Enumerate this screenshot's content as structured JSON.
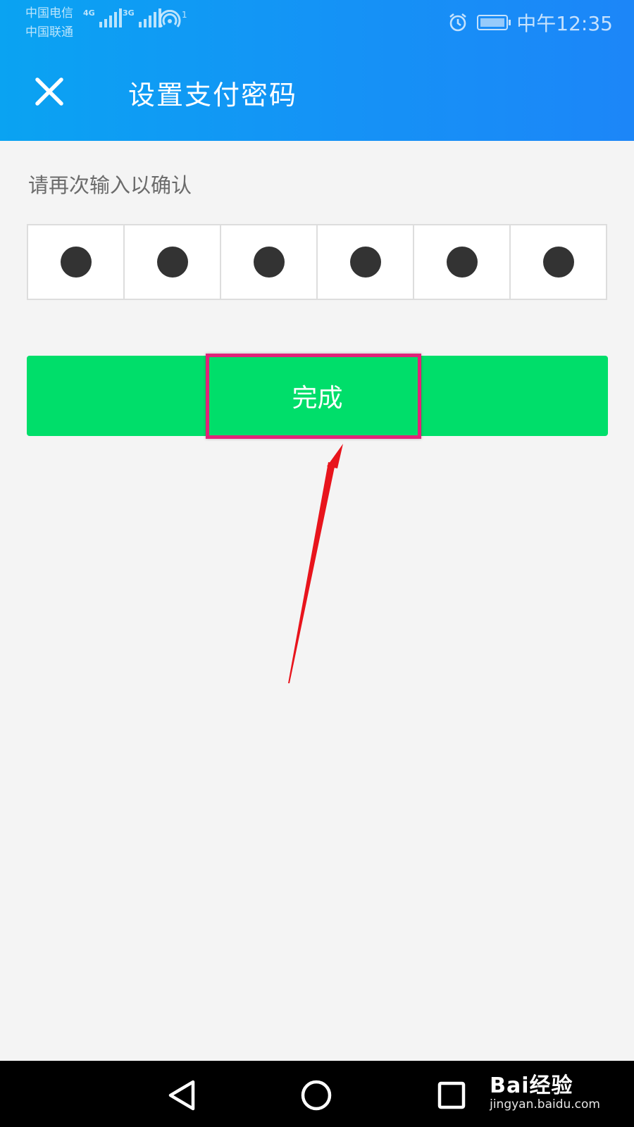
{
  "status_bar": {
    "carrier1": "中国电信",
    "carrier2": "中国联通",
    "network1": "4G",
    "network2": "3G",
    "hotspot_count": "1",
    "time": "中午12:35"
  },
  "header": {
    "title": "设置支付密码",
    "close_icon": "close-icon"
  },
  "prompt": "请再次输入以确认",
  "pin": {
    "length": 6,
    "filled": 6
  },
  "done_button": {
    "label": "完成",
    "color": "#00de6a"
  },
  "colors": {
    "header_gradient_start": "#0aa3f2",
    "header_gradient_end": "#1c86f8",
    "highlight_border": "#e2227a",
    "arrow": "#e8141c"
  },
  "watermark": {
    "brand": "Bai经验",
    "url": "jingyan.baidu.com"
  },
  "nav_bar": {
    "back_icon": "back-triangle-icon",
    "home_icon": "home-circle-icon",
    "recent_icon": "recent-square-icon"
  }
}
